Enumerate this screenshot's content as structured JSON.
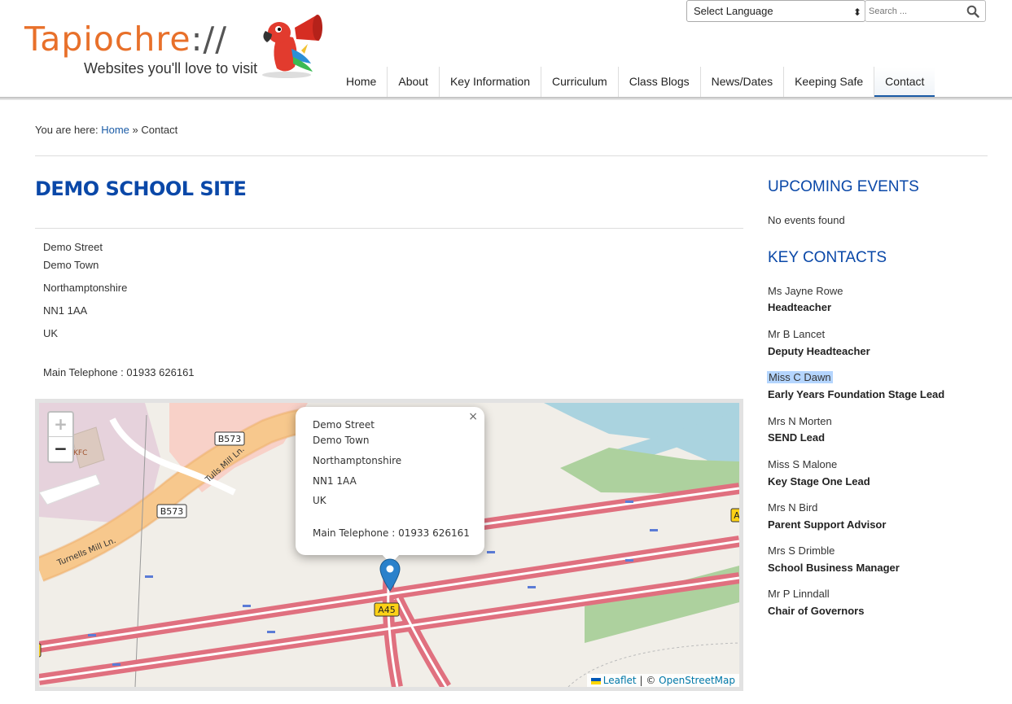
{
  "header": {
    "logo_text": "Tapiochre",
    "logo_slashes": "://",
    "logo_tagline": "Websites you'll love to visit",
    "language_select": "Select Language",
    "search_placeholder": "Search ...",
    "accent_color": "#e8702a",
    "brand_color": "#0a48a8"
  },
  "nav": {
    "items": [
      "Home",
      "About",
      "Key Information",
      "Curriculum",
      "Class Blogs",
      "News/Dates",
      "Keeping Safe",
      "Contact"
    ],
    "active": "Contact"
  },
  "breadcrumb": {
    "prefix": "You are here:",
    "home": "Home",
    "separator": "»",
    "current": "Contact"
  },
  "main": {
    "title": "DEMO SCHOOL SITE",
    "address": {
      "street": "Demo Street",
      "town": "Demo Town",
      "county": "Northamptonshire",
      "postcode": "NN1 1AA",
      "country": "UK"
    },
    "telephone": "Main Telephone : 01933 626161"
  },
  "map": {
    "zoom_in": "+",
    "zoom_out": "−",
    "popup": {
      "street": "Demo Street",
      "town": "Demo Town",
      "county": "Northamptonshire",
      "postcode": "NN1 1AA",
      "country": "UK",
      "telephone": "Main Telephone : 01933 626161",
      "close": "×"
    },
    "labels": {
      "b573_a": "B573",
      "b573_b": "B573",
      "a45": "A45",
      "a_edge": "A",
      "tulls": "Tulls Mill Ln.",
      "turnells": "Turnells Mill Ln.",
      "kfc": "KFC"
    },
    "attribution": {
      "leaflet": "Leaflet",
      "sep": "| ©",
      "osm": "OpenStreetMap"
    }
  },
  "sidebar": {
    "events_heading": "UPCOMING EVENTS",
    "events_empty": "No events found",
    "contacts_heading": "KEY CONTACTS",
    "contacts": [
      {
        "name": "Ms Jayne Rowe",
        "role": "Headteacher"
      },
      {
        "name": "Mr B Lancet",
        "role": "Deputy Headteacher"
      },
      {
        "name": "Miss C Dawn",
        "role": "Early Years Foundation Stage Lead"
      },
      {
        "name": "Mrs N Morten",
        "role": "SEND Lead"
      },
      {
        "name": "Miss S Malone",
        "role": "Key Stage One Lead"
      },
      {
        "name": "Mrs N Bird",
        "role": "Parent Support Advisor"
      },
      {
        "name": "Mrs S Drimble",
        "role": "School Business Manager"
      },
      {
        "name": "Mr P Linndall",
        "role": "Chair of Governors"
      }
    ]
  }
}
